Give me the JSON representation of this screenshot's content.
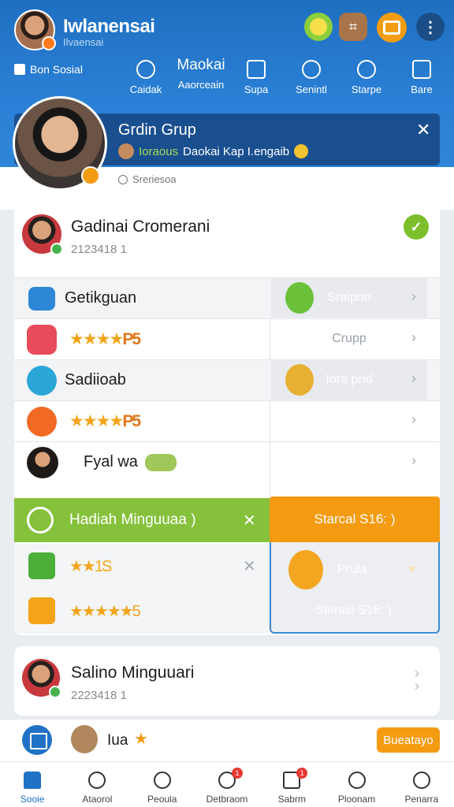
{
  "app": {
    "title": "Iwlanensai",
    "subtitle": "Ilvaensai"
  },
  "header": {
    "group_label": "Bon Sosial",
    "tabs": [
      {
        "label": "Caidak"
      },
      {
        "label": "Aaorceain",
        "heading": "Maokai"
      },
      {
        "label": "Supa"
      },
      {
        "label": "Senintl"
      },
      {
        "label": "Starpe"
      },
      {
        "label": "Bare"
      }
    ]
  },
  "banner": {
    "title": "Grdin Grup",
    "sub_highlight": "Ioraous",
    "sub_text": "Daokai Kap I.engaib",
    "status": "Sreriesoa"
  },
  "profile": {
    "name": "Gadinai Cromerani",
    "id": "2123418 1"
  },
  "rows": [
    {
      "label": "Getikguan",
      "stars": "★★★★",
      "right": "Sraipon"
    },
    {
      "stars": "★★★★",
      "suffix": "P5",
      "right": "Crupp"
    },
    {
      "label": "Sadiioab",
      "right": "Iora prid"
    },
    {
      "stars": "★★★★",
      "suffix": "P5"
    },
    {
      "label": "Fyal wa"
    }
  ],
  "reward": {
    "title": "Hadiah Minguuaa )",
    "button": "Starcal S16: )",
    "row1_stars": "★★1S",
    "row2_stars": "★★★★★5",
    "panel_label1": "Prula",
    "panel_label2": "Sterasl S16: )"
  },
  "profile2": {
    "name": "Salino Minguuari",
    "id": "2223418 1"
  },
  "action": {
    "text": "Iua",
    "button": "Bueatayo"
  },
  "nav": [
    {
      "label": "Sooie",
      "active": true
    },
    {
      "label": "Ataorol"
    },
    {
      "label": "Peoula",
      "badge": ""
    },
    {
      "label": "Detbraom",
      "badge": "1"
    },
    {
      "label": "Sabrm",
      "badge": "1"
    },
    {
      "label": "Ploonam"
    },
    {
      "label": "Penarra"
    }
  ],
  "colors": {
    "header": "#2a80d6",
    "banner": "#1a4f8f",
    "accent": "#f49b12",
    "success": "#86c13c"
  }
}
